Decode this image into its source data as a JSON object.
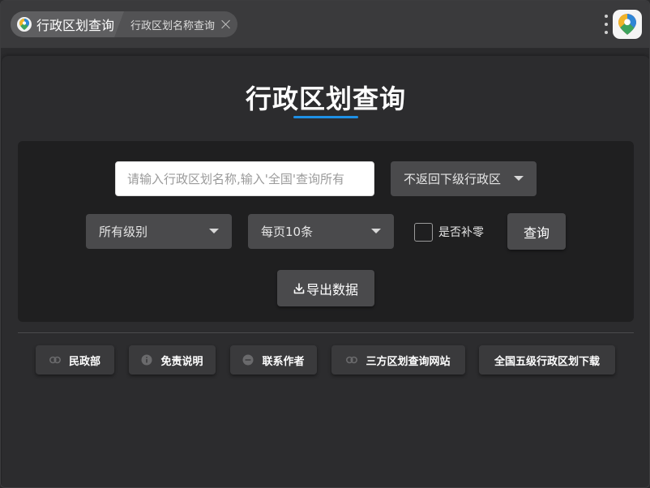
{
  "window": {
    "tab_main_label": "行政区划查询",
    "tab_sub_label": "行政区划名称查询"
  },
  "main": {
    "title": "行政区划查询",
    "accent_color": "#1e90e6",
    "search": {
      "placeholder": "请输入行政区划名称,输入'全国'查询所有",
      "value": ""
    },
    "return_mode_select": {
      "selected": "不返回下级行政区"
    },
    "level_select": {
      "selected": "所有级别"
    },
    "page_size_select": {
      "selected": "每页10条"
    },
    "zero_pad_checkbox": {
      "label": "是否补零",
      "checked": false
    },
    "query_button": "查询",
    "export_button": "导出数据"
  },
  "links": [
    {
      "label": "民政部",
      "icon": "link-icon"
    },
    {
      "label": "免责说明",
      "icon": "info-icon"
    },
    {
      "label": "联系作者",
      "icon": "chat-icon"
    },
    {
      "label": "三方区划查询网站",
      "icon": "link-icon"
    },
    {
      "label": "全国五级行政区划下载",
      "icon": ""
    }
  ]
}
